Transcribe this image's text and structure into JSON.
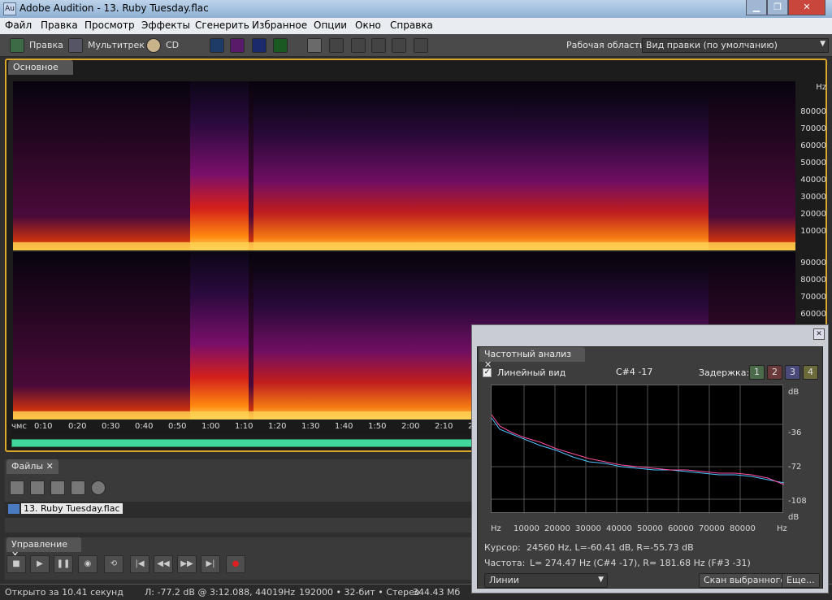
{
  "window": {
    "title": "Adobe Audition - 13. Ruby Tuesday.flac",
    "app_icon": "Au"
  },
  "menu": [
    "Файл",
    "Правка",
    "Просмотр",
    "Эффекты",
    "Сгенерить",
    "Избранное",
    "Опции",
    "Окно",
    "Справка"
  ],
  "toolbar": {
    "edit_label": "Правка",
    "multitrack_label": "Мультитрек",
    "cd_label": "CD",
    "workspace_label": "Рабочая область:",
    "workspace_value": "Вид правки (по умолчанию)"
  },
  "main": {
    "tab_label": "Основное",
    "hz_unit": "Hz",
    "hz_top": [
      "80000",
      "70000",
      "60000",
      "50000",
      "40000",
      "30000",
      "20000",
      "10000"
    ],
    "hz_bottom": [
      "90000",
      "80000",
      "70000",
      "60000"
    ],
    "timeline": [
      "чмс",
      "0:10",
      "0:20",
      "0:30",
      "0:40",
      "0:50",
      "1:00",
      "1:10",
      "1:20",
      "1:30",
      "1:40",
      "1:50",
      "2:00",
      "2:10",
      "2"
    ]
  },
  "files": {
    "tab_label": "Файлы",
    "file_name": "13. Ruby Tuesday.flac"
  },
  "transport": {
    "tab_label": "Управление"
  },
  "status": {
    "opened": "Открыто за 10.41 секунд",
    "level": "Л: -77.2 dB @ 3:12.088, 44019Hz",
    "format": "192000 • 32-бит • Стерео",
    "size": "344.43 Мб"
  },
  "freq": {
    "tab_label": "Частотный анализ",
    "linear_label": "Линейный вид",
    "note": "C#4 -17",
    "delay_label": "Задержка:",
    "delay_buttons": [
      "1",
      "2",
      "3",
      "4"
    ],
    "db_labels": [
      "dB",
      "-36",
      "-72",
      "-108",
      "dB"
    ],
    "x_labels": [
      "Hz",
      "10000",
      "20000",
      "30000",
      "40000",
      "50000",
      "60000",
      "70000",
      "80000",
      "Hz"
    ],
    "cursor_label": "Курсор:",
    "cursor_value": "24560 Hz, L=-60.41 dB, R=-55.73 dB",
    "freq_label": "Частота:",
    "freq_value": "L= 274.47 Hz (C#4 -17), R= 181.68 Hz (F#3 -31)",
    "mode": "Линии",
    "scan_button": "Скан выбранного",
    "more_button": "Еще...",
    "series_colors": {
      "left": "#ff4fa0",
      "right": "#4fc3ff"
    }
  }
}
